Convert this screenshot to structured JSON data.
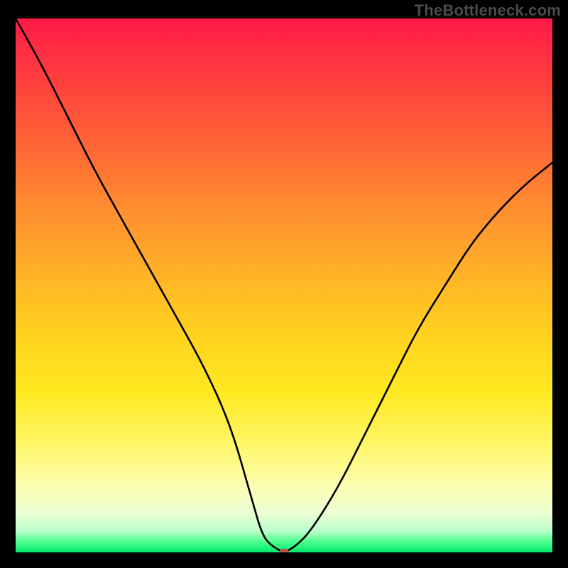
{
  "watermark": {
    "text": "TheBottleneck.com"
  },
  "chart_data": {
    "type": "line",
    "title": "",
    "xlabel": "",
    "ylabel": "",
    "xlim": [
      0,
      100
    ],
    "ylim": [
      0,
      100
    ],
    "grid": false,
    "legend": false,
    "series": [
      {
        "name": "bottleneck-curve",
        "x": [
          0,
          5,
          10,
          15,
          20,
          25,
          30,
          35,
          40,
          44,
          46,
          48,
          50,
          52,
          55,
          60,
          65,
          70,
          75,
          80,
          85,
          90,
          95,
          100
        ],
        "values": [
          100,
          91,
          81,
          71,
          62,
          53,
          44,
          35,
          24,
          10,
          3,
          1,
          0,
          1,
          4,
          12,
          22,
          32,
          42,
          50,
          58,
          64,
          69,
          73
        ]
      }
    ],
    "marker": {
      "x": 50,
      "y": 0,
      "color": "#c05048"
    },
    "background_gradient": {
      "top": "#ff1a48",
      "mid": "#ffd41f",
      "bottom": "#00e86b"
    }
  }
}
